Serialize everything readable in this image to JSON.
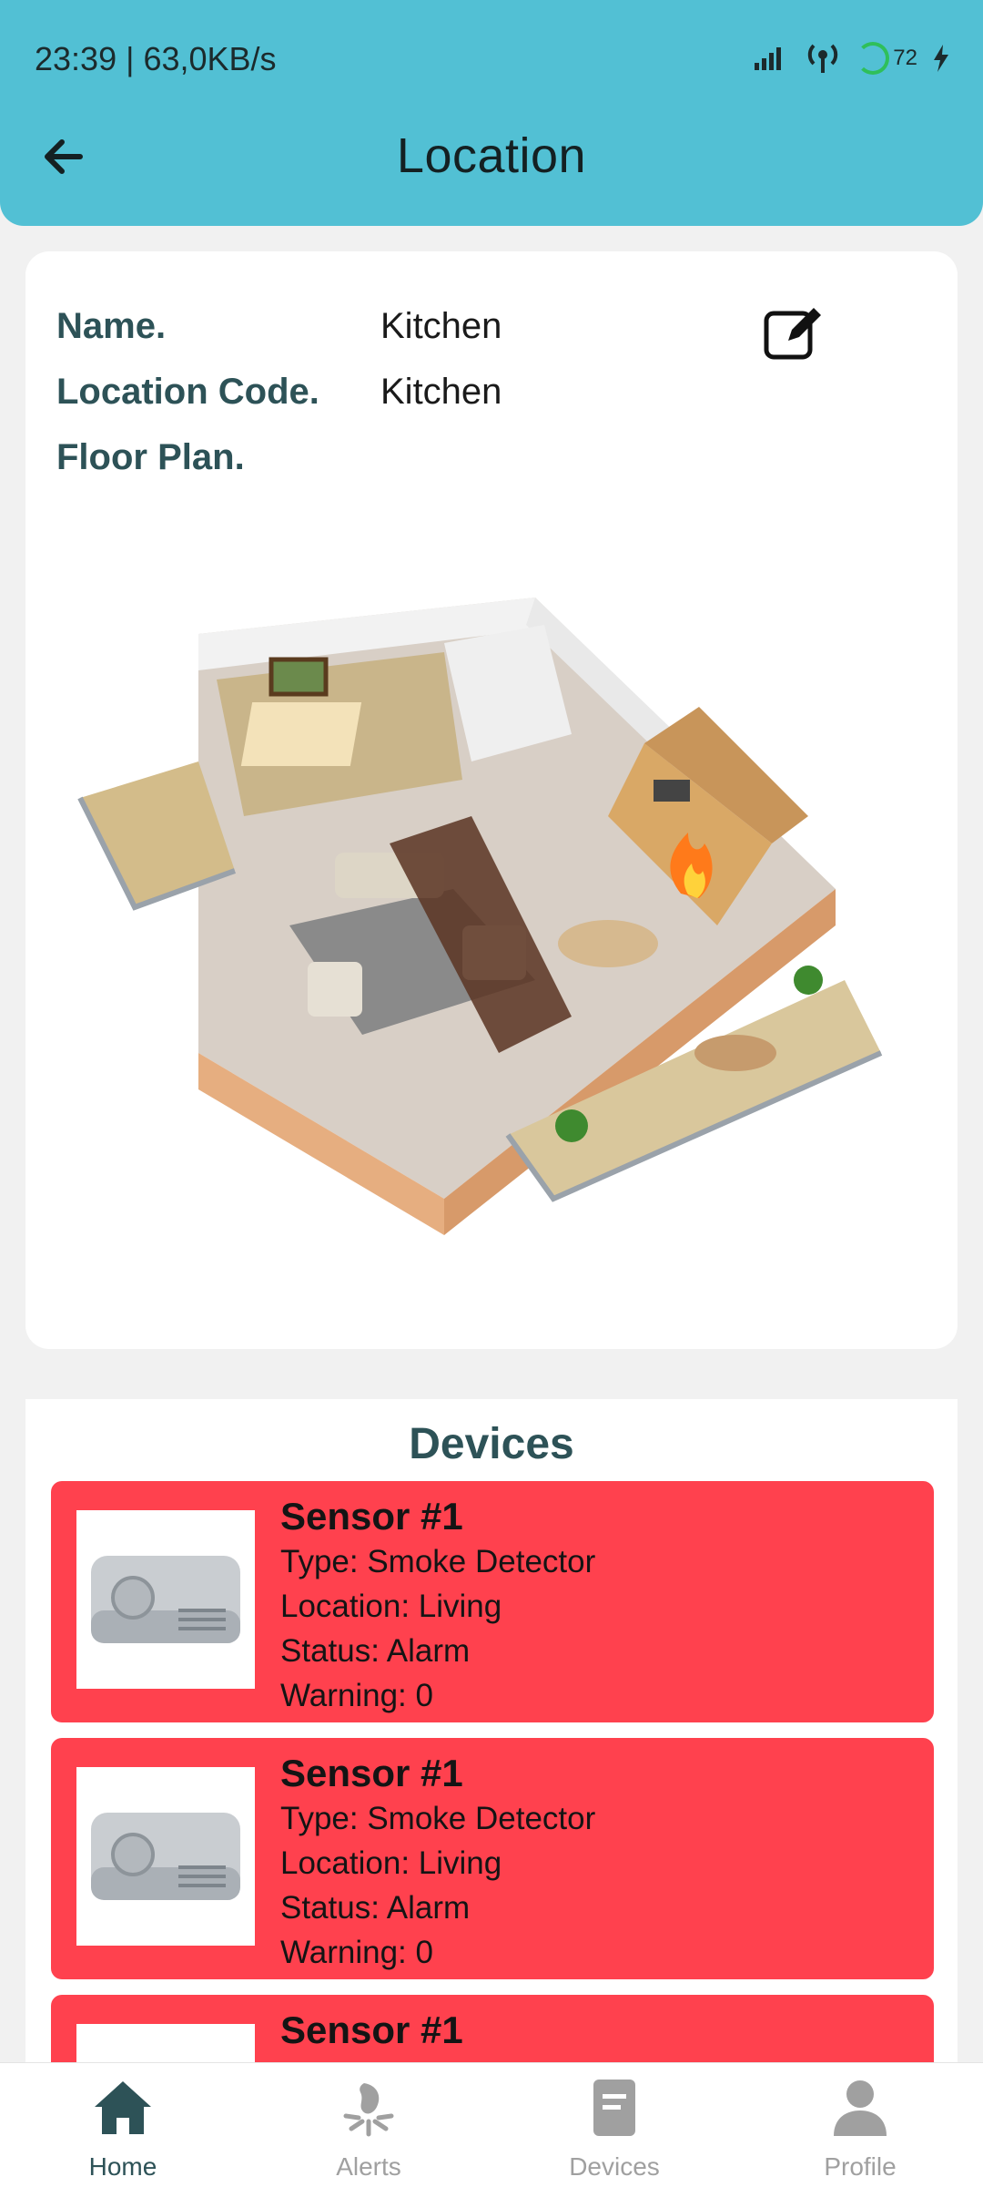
{
  "status_bar": {
    "time": "23:39 | 63,0KB/s",
    "battery": "72"
  },
  "header": {
    "title": "Location"
  },
  "info": {
    "name_label": "Name.",
    "name_value": "Kitchen",
    "code_label": "Location Code.",
    "code_value": "Kitchen",
    "floor_label": "Floor Plan."
  },
  "devices": {
    "title": "Devices",
    "items": [
      {
        "name": "Sensor #1",
        "type": "Type: Smoke Detector",
        "location": "Location: Living",
        "status": "Status: Alarm",
        "warning": "Warning: 0"
      },
      {
        "name": "Sensor #1",
        "type": "Type: Smoke Detector",
        "location": "Location: Living",
        "status": "Status: Alarm",
        "warning": "Warning: 0"
      },
      {
        "name": "Sensor #1"
      }
    ]
  },
  "nav": {
    "items": [
      {
        "label": "Home",
        "icon": "home-icon"
      },
      {
        "label": "Alerts",
        "icon": "alerts-icon"
      },
      {
        "label": "Devices",
        "icon": "devices-icon"
      },
      {
        "label": "Profile",
        "icon": "profile-icon"
      }
    ]
  },
  "colors": {
    "header": "#52c0d4",
    "alarm_card": "#ff414e",
    "label": "#2d5257"
  }
}
